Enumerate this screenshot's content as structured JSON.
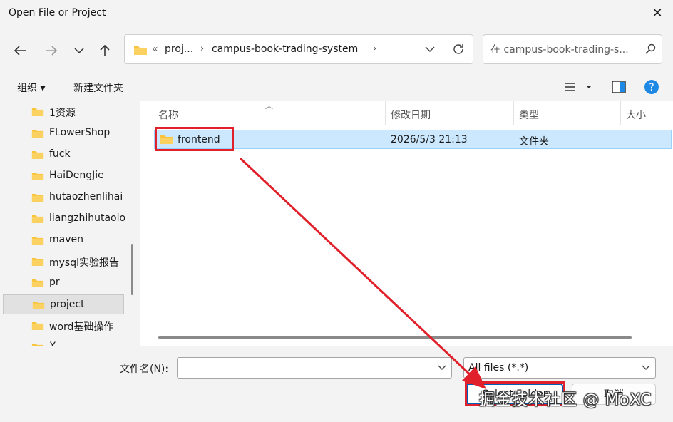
{
  "window": {
    "title": "Open File or Project",
    "close_icon": "close-icon"
  },
  "nav": {
    "back_icon": "back-arrow-icon",
    "forward_icon": "forward-arrow-icon",
    "recent_icon": "chevron-down-icon",
    "up_icon": "up-arrow-icon"
  },
  "address": {
    "overflow": "«",
    "segments": [
      "proj...",
      "campus-book-trading-system"
    ],
    "dropdown_icon": "chevron-down-icon",
    "refresh_icon": "refresh-icon"
  },
  "search": {
    "placeholder": "在 campus-book-trading-s...",
    "icon": "search-icon"
  },
  "commands": {
    "organize": "组织 ▾",
    "new_folder": "新建文件夹",
    "view_icon": "list-view-icon",
    "preview_icon": "preview-pane-icon",
    "help_icon": "help-icon",
    "help_glyph": "?"
  },
  "sidebar": {
    "items": [
      {
        "label": "1资源",
        "selected": false
      },
      {
        "label": "FLowerShop",
        "selected": false
      },
      {
        "label": "fuck",
        "selected": false
      },
      {
        "label": "HaiDengJie",
        "selected": false
      },
      {
        "label": "hutaozhenlihai",
        "selected": false
      },
      {
        "label": "liangzhihutaolo",
        "selected": false
      },
      {
        "label": "maven",
        "selected": false
      },
      {
        "label": "mysql实验报告",
        "selected": false
      },
      {
        "label": "pr",
        "selected": false
      },
      {
        "label": "project",
        "selected": true
      },
      {
        "label": "word基础操作",
        "selected": false
      },
      {
        "label": "X",
        "selected": false
      }
    ]
  },
  "columns": {
    "name": "名称",
    "modified": "修改日期",
    "type": "类型",
    "size": "大小"
  },
  "files": [
    {
      "name": "frontend",
      "modified": "2026/5/3 21:13",
      "type": "文件夹",
      "size": ""
    }
  ],
  "bottom": {
    "filename_label": "文件名(N):",
    "filename_value": "",
    "filter_value": "All files (*.*)",
    "open_label": "Select Folder",
    "cancel_label": "取消"
  },
  "watermark": "掘金技术社区 @ MoXC",
  "colors": {
    "accent": "#005fb8",
    "annotation": "#e0202a",
    "selection": "#cce8ff",
    "folder": "#f8c43c"
  }
}
